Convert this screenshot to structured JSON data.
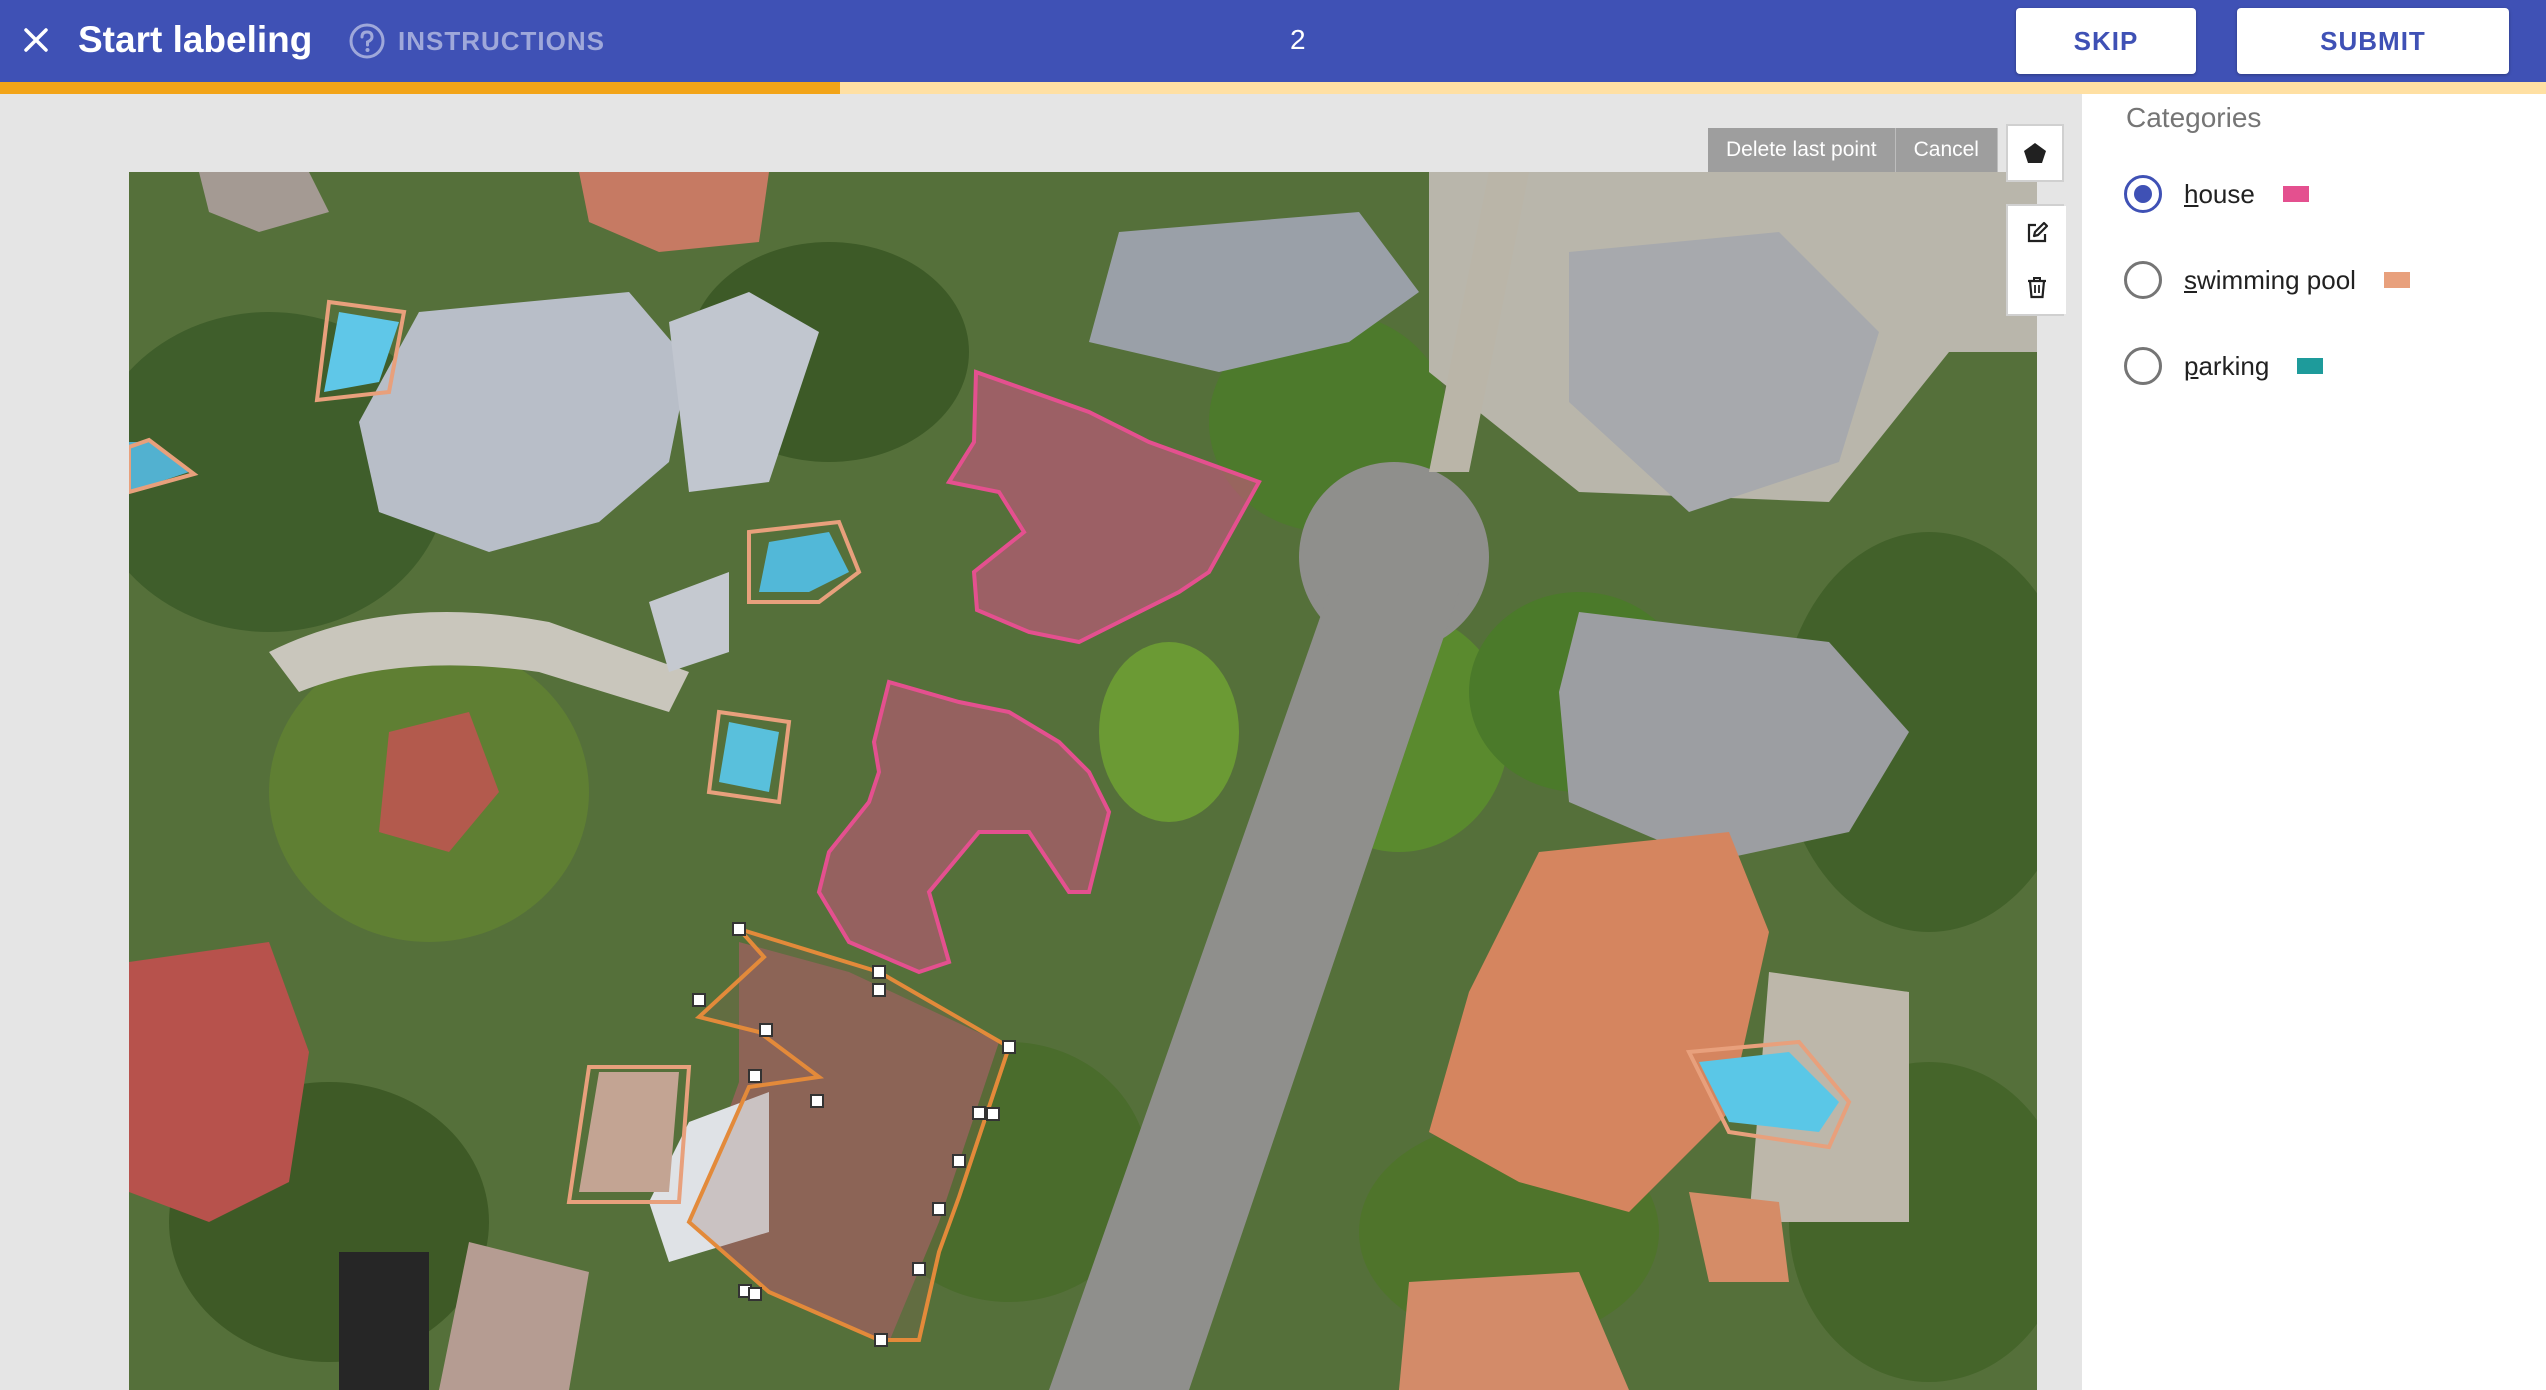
{
  "header": {
    "title": "Start labeling",
    "instructions_label": "INSTRUCTIONS",
    "counter": "2",
    "skip_label": "SKIP",
    "submit_label": "SUBMIT",
    "progress_percent": 33
  },
  "toolbar": {
    "delete_last_point_label": "Delete last point",
    "cancel_label": "Cancel",
    "tools": [
      "polygon-icon",
      "edit-icon",
      "trash-icon"
    ]
  },
  "sidebar": {
    "title": "Categories",
    "categories": [
      {
        "label": "house",
        "color": "#e4508f",
        "selected": true
      },
      {
        "label": "swimming pool",
        "color": "#e8a07c",
        "selected": false
      },
      {
        "label": "parking",
        "color": "#1e9b9b",
        "selected": false
      }
    ]
  },
  "colors": {
    "primary": "#3f51b5",
    "progress": "#f2a418",
    "house": "#e4508f",
    "swimming_pool": "#e8a07c",
    "parking": "#1e9b9b"
  }
}
